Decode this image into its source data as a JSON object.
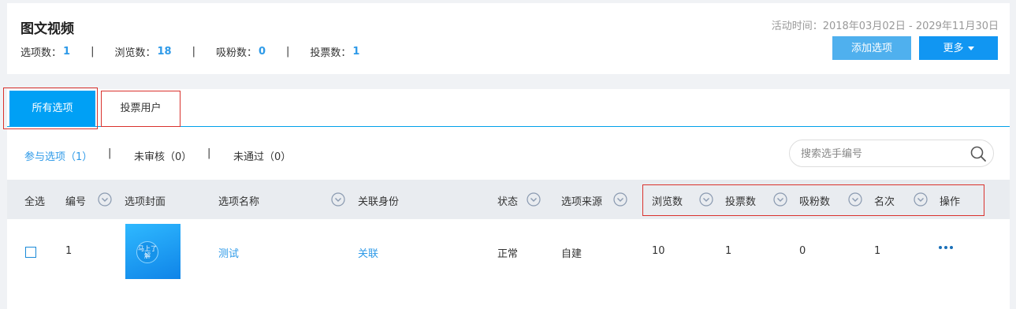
{
  "header": {
    "title": "图文视频",
    "activity_time": "活动时间：2018年03月02日 - 2029年11月30日",
    "stats": [
      {
        "label": "选项数：",
        "value": "1"
      },
      {
        "label": "浏览数：",
        "value": "18"
      },
      {
        "label": "吸粉数：",
        "value": "0"
      },
      {
        "label": "投票数：",
        "value": "1"
      }
    ],
    "separator": "|",
    "add_button": "添加选项",
    "more_button": "更多"
  },
  "tabs": [
    {
      "label": "所有选项",
      "active": true
    },
    {
      "label": "投票用户",
      "active": false
    }
  ],
  "filters": [
    {
      "label": "参与选项（1）",
      "active": true
    },
    {
      "label": "未审核（0）",
      "active": false
    },
    {
      "label": "未通过（0）",
      "active": false
    }
  ],
  "search": {
    "placeholder": "搜索选手编号"
  },
  "table": {
    "columns": [
      "全选",
      "编号",
      "选项封面",
      "选项名称",
      "关联身份",
      "状态",
      "选项来源",
      "浏览数",
      "投票数",
      "吸粉数",
      "名次",
      "操作"
    ],
    "rows": [
      {
        "id": "1",
        "cover_text": "马上了解",
        "name": "测试",
        "identity": "关联",
        "status": "正常",
        "source": "自建",
        "views": "10",
        "votes": "1",
        "fans": "0",
        "rank": "1"
      }
    ]
  },
  "colors": {
    "accent": "#00a0f5",
    "link": "#2e9ae8",
    "annotation": "#d9322d"
  }
}
